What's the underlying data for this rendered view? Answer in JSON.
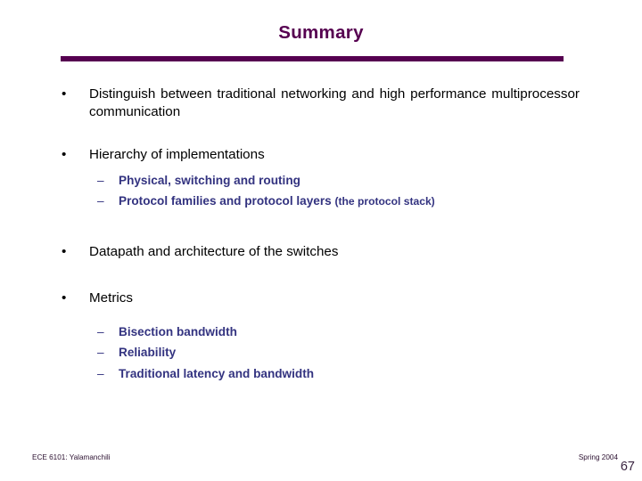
{
  "slide": {
    "title": "Summary",
    "bullet_marker": "•",
    "sub_marker": "–",
    "content": [
      {
        "level": 1,
        "text": "Distinguish between traditional networking and high performance multiprocessor communication"
      },
      {
        "level": 1,
        "text": "Hierarchy of implementations"
      },
      {
        "level": 2,
        "text": "Physical, switching and routing"
      },
      {
        "level": 2,
        "text": "Protocol families and protocol layers ",
        "note": "(the protocol stack)"
      },
      {
        "level": 1,
        "text": "Datapath and architecture of the switches"
      },
      {
        "level": 1,
        "text": "Metrics"
      },
      {
        "level": 2,
        "text": "Bisection bandwidth"
      },
      {
        "level": 2,
        "text": "Reliability"
      },
      {
        "level": 2,
        "text": "Traditional latency and bandwidth"
      }
    ],
    "footer": {
      "course": "ECE 6101: Yalamanchili",
      "term": "Spring 2004",
      "page_number": "67"
    },
    "colors": {
      "title": "#560050",
      "rule": "#560050",
      "level1_text": "#000000",
      "level2_text": "#333380",
      "footer_text": "#2b1030",
      "background": "#ffffff"
    }
  }
}
